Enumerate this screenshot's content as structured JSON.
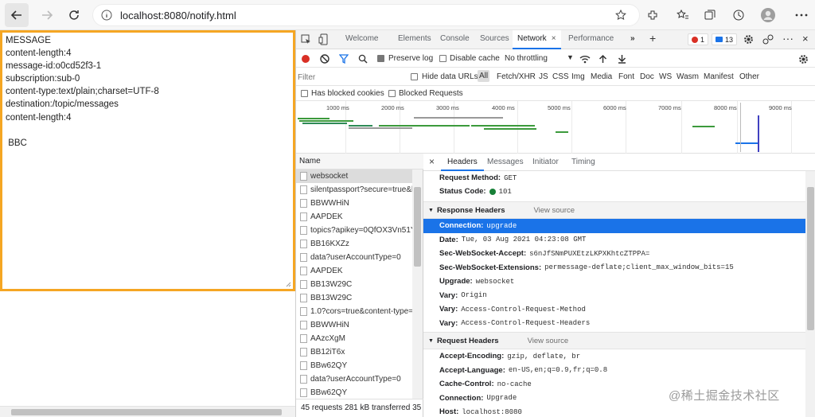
{
  "browser": {
    "url": "localhost:8080/notify.html"
  },
  "page": {
    "message_text": "MESSAGE\ncontent-length:4\nmessage-id:o0cd52f3-1\nsubscription:sub-0\ncontent-type:text/plain;charset=UTF-8\ndestination:/topic/messages\ncontent-length:4\n\n BBC"
  },
  "devtools": {
    "tabs": [
      "Welcome",
      "Elements",
      "Console",
      "Sources",
      "Network",
      "Performance"
    ],
    "errors_badge": "1",
    "messages_badge": "13",
    "toolbar": {
      "preserve_log": "Preserve log",
      "disable_cache": "Disable cache",
      "throttling": "No throttling"
    },
    "filter": {
      "placeholder": "Filter",
      "hide_data_urls": "Hide data URLs",
      "types": [
        "All",
        "Fetch/XHR",
        "JS",
        "CSS",
        "Img",
        "Media",
        "Font",
        "Doc",
        "WS",
        "Wasm",
        "Manifest",
        "Other"
      ],
      "blocked_cookies": "Has blocked cookies",
      "blocked_requests": "Blocked Requests"
    },
    "timeline_ticks": [
      "1000 ms",
      "2000 ms",
      "3000 ms",
      "4000 ms",
      "5000 ms",
      "6000 ms",
      "7000 ms",
      "8000 ms",
      "9000 ms"
    ],
    "list_header": "Name",
    "requests": [
      "websocket",
      "silentpassport?secure=true&lc",
      "BBWWHiN",
      "AAPDEK",
      "topics?apikey=0QfOX3Vn51Y...",
      "BB16KXZz",
      "data?userAccountType=0",
      "AAPDEK",
      "BB13W29C",
      "BB13W29C",
      "1.0?cors=true&content-type=",
      "BBWWHiN",
      "AAzcXgM",
      "BB12iT6x",
      "BBw62QY",
      "data?userAccountType=0",
      "BBw62QY"
    ],
    "list_footer": "45 requests   281 kB transferred   35",
    "detail_tabs": [
      "Headers",
      "Messages",
      "Initiator",
      "Timing"
    ],
    "close_label": "×",
    "general": [
      {
        "key": "Request Method:",
        "value": "GET"
      },
      {
        "key": "Status Code:",
        "value": "101"
      }
    ],
    "response_section": {
      "title": "Response Headers",
      "view_source": "View source"
    },
    "response_headers": [
      {
        "key": "Connection:",
        "value": "upgrade"
      },
      {
        "key": "Date:",
        "value": "Tue, 03 Aug 2021 04:23:08 GMT"
      },
      {
        "key": "Sec-WebSocket-Accept:",
        "value": "s6nJfSNmPUXEtzLKPXKhtcZTPPA="
      },
      {
        "key": "Sec-WebSocket-Extensions:",
        "value": "permessage-deflate;client_max_window_bits=15"
      },
      {
        "key": "Upgrade:",
        "value": "websocket"
      },
      {
        "key": "Vary:",
        "value": "Origin"
      },
      {
        "key": "Vary:",
        "value": "Access-Control-Request-Method"
      },
      {
        "key": "Vary:",
        "value": "Access-Control-Request-Headers"
      }
    ],
    "request_section": {
      "title": "Request Headers",
      "view_source": "View source"
    },
    "request_headers": [
      {
        "key": "Accept-Encoding:",
        "value": "gzip, deflate, br"
      },
      {
        "key": "Accept-Language:",
        "value": "en-US,en;q=0.9,fr;q=0.8"
      },
      {
        "key": "Cache-Control:",
        "value": "no-cache"
      },
      {
        "key": "Connection:",
        "value": "Upgrade"
      },
      {
        "key": "Host:",
        "value": "localhost:8080"
      }
    ]
  },
  "watermark": "@稀土掘金技术社区",
  "colors": {
    "accent": "#1a73e8",
    "page_border": "#f5a623",
    "record": "#d93025"
  }
}
